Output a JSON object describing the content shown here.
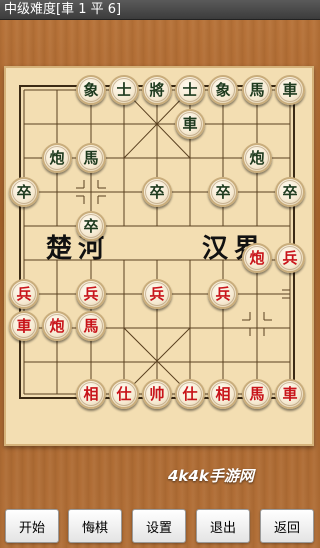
{
  "titlebar": {
    "text": "中级难度[車 1 平 6]"
  },
  "river": {
    "left_1": "楚",
    "left_2": "河",
    "right_1": "汉",
    "right_2": "界"
  },
  "watermark": "4k4k手游网",
  "pieces": {
    "b_xiang_l": "象",
    "b_shi_l": "士",
    "b_jiang": "將",
    "b_shi_r": "士",
    "b_xiang_r": "象",
    "b_ma_r": "馬",
    "b_che_r": "車",
    "b_che_2": "車",
    "b_pao_l": "炮",
    "b_ma_l": "馬",
    "b_pao_r": "炮",
    "b_zu_1": "卒",
    "b_zu_3": "卒",
    "b_zu_4": "卒",
    "b_zu_5": "卒",
    "b_zu_2": "卒",
    "r_pao_river": "炮",
    "r_bing_r": "兵",
    "r_bing_1": "兵",
    "r_bing_2": "兵",
    "r_bing_3": "兵",
    "r_bing_4": "兵",
    "r_che_l": "車",
    "r_pao_l": "炮",
    "r_ma_l": "馬",
    "r_xiang_l": "相",
    "r_shi_l": "仕",
    "r_shuai": "帅",
    "r_shi_r": "仕",
    "r_xiang_r": "相",
    "r_ma_r": "馬",
    "r_che_r": "車"
  },
  "toolbar": {
    "start": "开始",
    "undo": "悔棋",
    "settings": "设置",
    "exit": "退出",
    "back": "返回"
  },
  "colors": {
    "red_piece": "#c8141a",
    "black_piece": "#1e3a1e",
    "board": "#f3deb2",
    "wood": "#b06e36"
  }
}
